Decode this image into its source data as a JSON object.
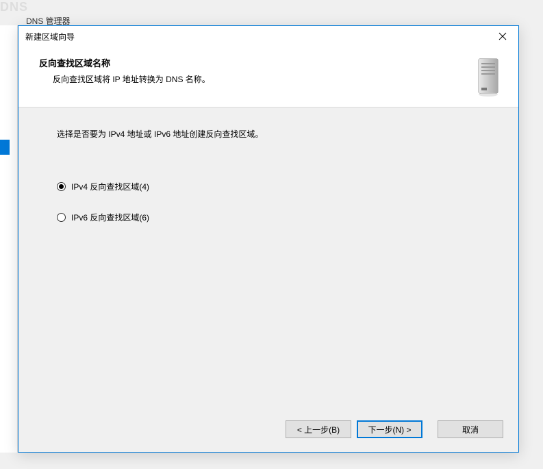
{
  "backdrop": {
    "app_title": "DNS",
    "manager_label": "DNS 管理器"
  },
  "dialog": {
    "title": "新建区域向导",
    "header": {
      "title": "反向查找区域名称",
      "subtitle": "反向查找区域将 IP 地址转换为 DNS 名称。"
    },
    "instruction": "选择是否要为 IPv4 地址或 IPv6 地址创建反向查找区域。",
    "options": {
      "ipv4": "IPv4 反向查找区域(4)",
      "ipv6": "IPv6 反向查找区域(6)",
      "selected": "ipv4"
    },
    "buttons": {
      "back": "< 上一步(B)",
      "next": "下一步(N) >",
      "cancel": "取消"
    }
  }
}
